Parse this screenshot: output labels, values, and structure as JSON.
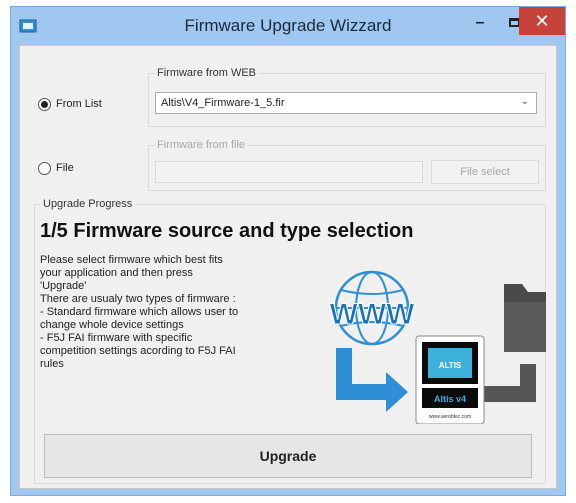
{
  "window": {
    "title": "Firmware Upgrade Wizzard",
    "min_glyph": "–",
    "close_glyph": "✕"
  },
  "source": {
    "from_list_label": "From List",
    "file_label": "File",
    "web_group_title": "Firmware from WEB",
    "web_selected": "Altis\\V4_Firmware-1_5.fir",
    "file_group_title": "Firmware from file",
    "file_value": "",
    "file_select_label": "File select"
  },
  "progress": {
    "group_title": "Upgrade Progress",
    "heading": "1/5 Firmware source and type selection",
    "description_lines": [
      "Please select firmware which best fits",
      "your application and then press",
      "'Upgrade'",
      "There are usualy two types of firmware :",
      "- Standard firmware which allows user to",
      "change whole device settings",
      "- F5J FAI firmware with specific",
      "competition settings acording to F5J FAI",
      "rules"
    ],
    "www_text": "WWW",
    "device_brand": "ALTIS",
    "device_name": "Altis v4",
    "device_url": "www.aerobtec.com"
  },
  "upgrade_label": "Upgrade",
  "colors": {
    "accent_blue": "#2f8fd6",
    "close_red": "#c7433a",
    "title_bg": "#9fc7f0"
  }
}
